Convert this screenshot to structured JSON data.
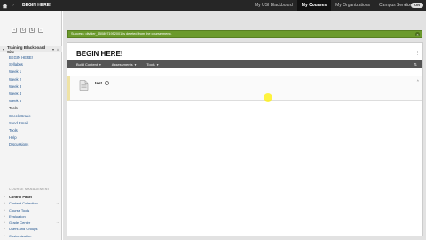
{
  "colors": {
    "topbar": "#262626",
    "success": "#6b9a2c",
    "toolbar": "#555555",
    "link": "#1a4f8b",
    "cursor_highlight": "#f6ef00"
  },
  "topbar": {
    "home_icon": "home-icon",
    "breadcrumb_separator": "›",
    "course_title": "BEGIN HERE!",
    "tabs": [
      {
        "label": "My USI Blackboard",
        "active": false
      },
      {
        "label": "My Courses",
        "active": true
      },
      {
        "label": "My Organizations",
        "active": false
      },
      {
        "label": "Campus Services",
        "active": false
      }
    ],
    "power_icon": "power-icon",
    "toggle_label": "ON"
  },
  "sidebar": {
    "menu_title": "Training Blackboard Site",
    "menu_items": [
      {
        "label": "BEGIN HERE!",
        "link": true
      },
      {
        "label": "Syllabus",
        "link": true
      },
      {
        "label": "Week 1",
        "link": true
      },
      {
        "label": "Week 2",
        "link": true
      },
      {
        "label": "Week 3",
        "link": true
      },
      {
        "label": "Week 4",
        "link": true
      },
      {
        "label": "Week 5",
        "link": true
      },
      {
        "label": "Tools",
        "link": false
      },
      {
        "label": "Check Grade",
        "link": true
      },
      {
        "label": "Send Email",
        "link": true
      },
      {
        "label": "Tools",
        "link": true
      },
      {
        "label": "Help",
        "link": true
      },
      {
        "label": "Discussions",
        "link": true
      }
    ],
    "course_management_label": "COURSE MANAGEMENT",
    "control_panel": [
      {
        "label": "Control Panel",
        "bold": true,
        "arrow": "▾"
      },
      {
        "label": "Content Collection",
        "bold": false,
        "arrow": "▸"
      },
      {
        "label": "Course Tools",
        "bold": false,
        "arrow": "▸"
      },
      {
        "label": "Evaluation",
        "bold": false,
        "arrow": "▸"
      },
      {
        "label": "Grade Center",
        "bold": false,
        "arrow": "▸"
      },
      {
        "label": "Users and Groups",
        "bold": false,
        "arrow": "▸"
      },
      {
        "label": "Customization",
        "bold": false,
        "arrow": "▸"
      }
    ]
  },
  "main": {
    "success_message": "Success: divider_1508071952001 is deleted from the course menu.",
    "page_title": "BEGIN HERE!",
    "toolbar": {
      "build_content": "Build Content",
      "assessments": "Assessments",
      "tools": "Tools"
    },
    "items": [
      {
        "title": "test"
      }
    ]
  }
}
